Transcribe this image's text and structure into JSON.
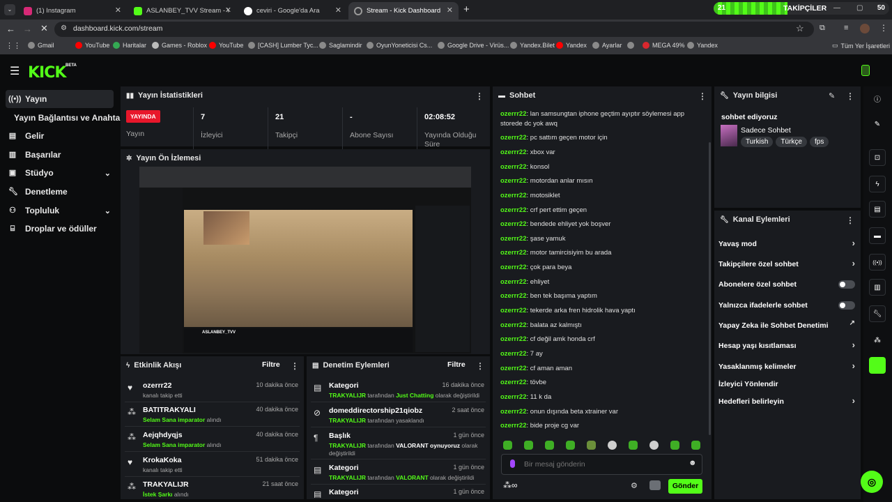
{
  "browser": {
    "tabs": [
      {
        "label": "(1) Instagram",
        "favicon_color": "#d62976"
      },
      {
        "label": "ASLANBEY_TVV Stream - Watch",
        "favicon_color": "#53fc18"
      },
      {
        "label": "ceviri - Google'da Ara",
        "favicon_color": "#4285f4"
      },
      {
        "label": "Stream - Kick Dashboard",
        "favicon_color": "#9a9a9a"
      }
    ],
    "url": "dashboard.kick.com/stream",
    "bookmarks": [
      "Gmail",
      "YouTube",
      "Haritalar",
      "Games - Roblox",
      "YouTube",
      "[CASH] Lumber Tyc...",
      "Saglamindir",
      "OyunYoneticisi Cs...",
      "Google Drive - Virüs...",
      "Yandex.Bilet",
      "Yandex",
      "Ayarlar",
      "MEGA 49%",
      "Yandex"
    ],
    "all_bookmarks": "Tüm Yer İşaretleri",
    "overlay": {
      "followers_label": "TAKİPÇİLER",
      "current": "21",
      "goal": "50",
      "progress": 0.42
    }
  },
  "kick": {
    "logo": "KICK",
    "beta": "BETA"
  },
  "sidebar": [
    {
      "label": "Yayın",
      "icon": "broadcast-icon"
    },
    {
      "label": "Yayın Bağlantısı ve Anahtarı",
      "icon": ""
    },
    {
      "label": "Gelir",
      "icon": "revenue-icon"
    },
    {
      "label": "Başarılar",
      "icon": "achievements-icon"
    },
    {
      "label": "Stüdyo",
      "icon": "studio-icon"
    },
    {
      "label": "Denetleme",
      "icon": "wrench-icon"
    },
    {
      "label": "Topluluk",
      "icon": "community-icon"
    },
    {
      "label": "Droplar ve ödüller",
      "icon": "gift-icon"
    }
  ],
  "stats": {
    "title": "Yayın İstatistikleri",
    "live_badge": "YAYINDA",
    "items": [
      {
        "value": "",
        "label": "Yayın"
      },
      {
        "value": "7",
        "label": "İzleyici"
      },
      {
        "value": "21",
        "label": "Takipçi"
      },
      {
        "value": "-",
        "label": "Abone Sayısı"
      },
      {
        "value": "02:08:52",
        "label": "Yayında Olduğu Süre"
      }
    ]
  },
  "preview": {
    "title": "Yayın Ön İzlemesi",
    "streamer": "ASLANBEY_TVV"
  },
  "activity": {
    "title": "Etkinlik Akışı",
    "filter": "Filtre",
    "items": [
      {
        "name": "ozerrr22",
        "pre": "kanalı takip etti",
        "highlight": "",
        "post": "",
        "time": "10 dakika önce",
        "icon": "heart-icon"
      },
      {
        "name": "BATITRAKYALI",
        "pre": "",
        "highlight": "Selam Sana imparator",
        "post": " alındı",
        "time": "40 dakika önce",
        "icon": "points-icon"
      },
      {
        "name": "Aejqhdyqjs",
        "pre": "",
        "highlight": "Selam Sana imparator",
        "post": " alındı",
        "time": "40 dakika önce",
        "icon": "points-icon"
      },
      {
        "name": "KrokaKoka",
        "pre": "kanalı takip etti",
        "highlight": "",
        "post": "",
        "time": "51 dakika önce",
        "icon": "heart-icon"
      },
      {
        "name": "TRAKYALIJR",
        "pre": "",
        "highlight": "İstek Şarkı",
        "post": " alındı",
        "time": "21 saat önce",
        "icon": "points-icon"
      }
    ]
  },
  "moderation": {
    "title": "Denetim Eylemleri",
    "filter": "Filtre",
    "items": [
      {
        "title": "Kategori",
        "time": "16 dakika önce",
        "actor": "TRAKYALIJR",
        "mid": " tarafından ",
        "value": "Just Chatting",
        "tail": " olarak değiştirildi",
        "icon": "category-icon"
      },
      {
        "title": "domeddirectorship21qiobz",
        "time": "2 saat önce",
        "actor": "TRAKYALIJR",
        "mid": " tarafından yasaklandı",
        "value": "",
        "tail": "",
        "icon": "ban-icon"
      },
      {
        "title": "Başlık",
        "time": "1 gün önce",
        "actor": "TRAKYALIJR",
        "mid": " tarafından ",
        "value": "VALORANT oynuyoruz",
        "tail": " olarak değiştirildi",
        "icon": "title-icon"
      },
      {
        "title": "Kategori",
        "time": "1 gün önce",
        "actor": "TRAKYALIJR",
        "mid": " tarafından ",
        "value": "VALORANT",
        "tail": " olarak değiştirildi",
        "icon": "category-icon"
      },
      {
        "title": "Kategori",
        "time": "1 gün önce",
        "actor": "",
        "mid": "",
        "value": "",
        "tail": "",
        "icon": "category-icon"
      }
    ]
  },
  "chat": {
    "title": "Sohbet",
    "messages": [
      {
        "user": "ozerrr22",
        "text": "lan samsungtan iphone geçtim ayıptır söylemesi app storede dc yok awq"
      },
      {
        "user": "ozerrr22",
        "text": "pc sattım geçen motor için"
      },
      {
        "user": "ozerrr22",
        "text": "xbox var"
      },
      {
        "user": "ozerrr22",
        "text": "konsol"
      },
      {
        "user": "ozerrr22",
        "text": "motordan anlar mısın"
      },
      {
        "user": "ozerrr22",
        "text": "motosiklet"
      },
      {
        "user": "ozerrr22",
        "text": "crf pert ettim geçen"
      },
      {
        "user": "ozerrr22",
        "text": "bendede ehliyet yok boşver"
      },
      {
        "user": "ozerrr22",
        "text": "şase yamuk"
      },
      {
        "user": "ozerrr22",
        "text": "motor tamircisiyim bu arada"
      },
      {
        "user": "ozerrr22",
        "text": "çok para beya"
      },
      {
        "user": "ozerrr22",
        "text": "ehliyet"
      },
      {
        "user": "ozerrr22",
        "text": "ben tek başıma yaptım"
      },
      {
        "user": "ozerrr22",
        "text": "tekerde arka fren hidrolik hava yaptı"
      },
      {
        "user": "ozerrr22",
        "text": "balata az kalmıştı"
      },
      {
        "user": "ozerrr22",
        "text": "cf değil amk honda crf"
      },
      {
        "user": "ozerrr22",
        "text": "7 ay"
      },
      {
        "user": "ozerrr22",
        "text": "cf aman aman"
      },
      {
        "user": "ozerrr22",
        "text": "tövbe"
      },
      {
        "user": "ozerrr22",
        "text": "11 k da"
      },
      {
        "user": "ozerrr22",
        "text": "onun dışında beta xtrainer var"
      },
      {
        "user": "ozerrr22",
        "text": "bide proje cg var"
      }
    ],
    "placeholder": "Bir mesaj gönderin",
    "send": "Gönder"
  },
  "stream_info": {
    "title": "Yayın bilgisi",
    "stream_title": "sohbet ediyoruz",
    "category": "Sadece Sohbet",
    "tags": [
      "Turkish",
      "Türkçe",
      "fps"
    ]
  },
  "channel_actions": {
    "title": "Kanal Eylemleri",
    "items": [
      {
        "label": "Yavaş mod",
        "control": "chevron"
      },
      {
        "label": "Takipçilere özel sohbet",
        "control": "chevron"
      },
      {
        "label": "Abonelere özel sohbet",
        "control": "toggle"
      },
      {
        "label": "Yalnızca ifadelerle sohbet",
        "control": "toggle"
      },
      {
        "label": "Yapay Zeka ile Sohbet Denetimi",
        "control": "external"
      },
      {
        "label": "Hesap yaşı kısıtlaması",
        "control": "chevron"
      },
      {
        "label": "Yasaklanmış kelimeler",
        "control": "chevron"
      },
      {
        "label": "İzleyici Yönlendir",
        "control": "none"
      },
      {
        "label": "Hedefleri belirleyin",
        "control": "chevron"
      }
    ]
  },
  "colors": {
    "accent": "#53fc18",
    "live": "#e8172b",
    "panel": "#191b1f"
  }
}
